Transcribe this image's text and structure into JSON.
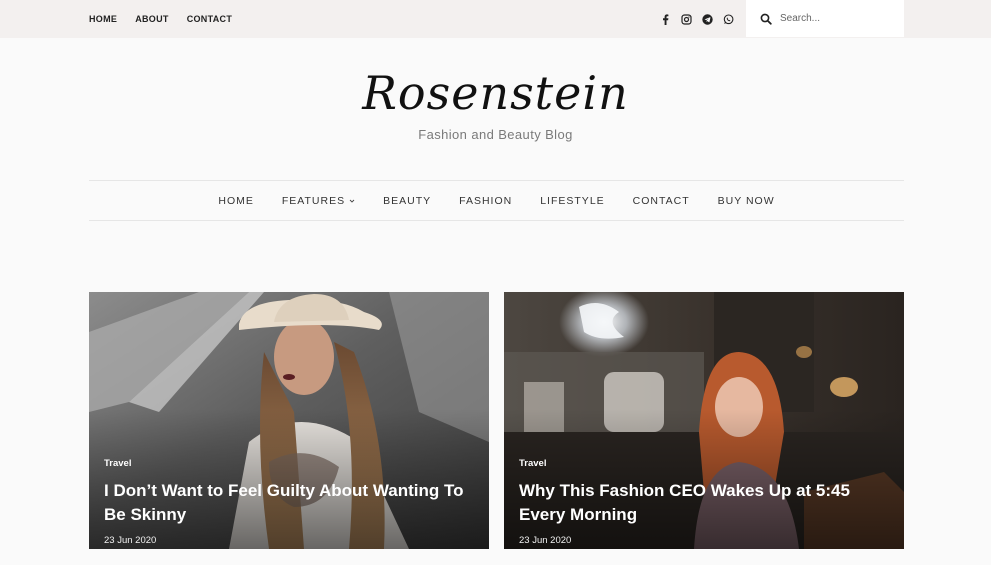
{
  "topbar": {
    "links": [
      "HOME",
      "ABOUT",
      "CONTACT"
    ],
    "socials": [
      "facebook-icon",
      "instagram-icon",
      "telegram-icon",
      "whatsapp-icon"
    ],
    "search": {
      "placeholder": "Search..."
    }
  },
  "brand": {
    "logo": "Rosenstein",
    "tagline": "Fashion and Beauty Blog"
  },
  "nav": {
    "items": [
      "HOME",
      "FEATURES",
      "BEAUTY",
      "FASHION",
      "LIFESTYLE",
      "CONTACT",
      "BUY NOW"
    ]
  },
  "posts": [
    {
      "category": "Travel",
      "title": "I Don’t Want to Feel Guilty About Wanting To Be Skinny",
      "date": "23 Jun 2020"
    },
    {
      "category": "Travel",
      "title": "Why This Fashion CEO Wakes Up at 5:45 Every Morning",
      "date": "23 Jun 2020"
    }
  ],
  "colors": {
    "topbar_bg": "#f3f0ef",
    "page_bg": "#fafafa",
    "text": "#222222"
  }
}
